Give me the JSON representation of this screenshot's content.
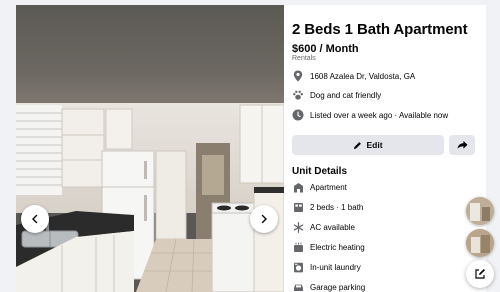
{
  "listing": {
    "title": "2 Beds 1 Bath Apartment",
    "price": "$600 / Month",
    "category": "Rentals",
    "address": "1608 Azalea Dr, Valdosta, GA",
    "pets": "Dog and cat friendly",
    "listed": "Listed over a week ago · Available now"
  },
  "actions": {
    "edit_label": "Edit"
  },
  "unit_details": {
    "heading": "Unit Details",
    "items": [
      {
        "icon": "building-icon",
        "label": "Apartment"
      },
      {
        "icon": "bed-icon",
        "label": "2 beds · 1 bath"
      },
      {
        "icon": "snowflake-icon",
        "label": "AC available"
      },
      {
        "icon": "heater-icon",
        "label": "Electric heating"
      },
      {
        "icon": "washer-icon",
        "label": "In-unit laundry"
      },
      {
        "icon": "car-icon",
        "label": "Garage parking"
      }
    ]
  },
  "colors": {
    "button_bg": "#e4e6eb",
    "secondary_text": "#65676b",
    "icon_gray": "#65676b"
  }
}
